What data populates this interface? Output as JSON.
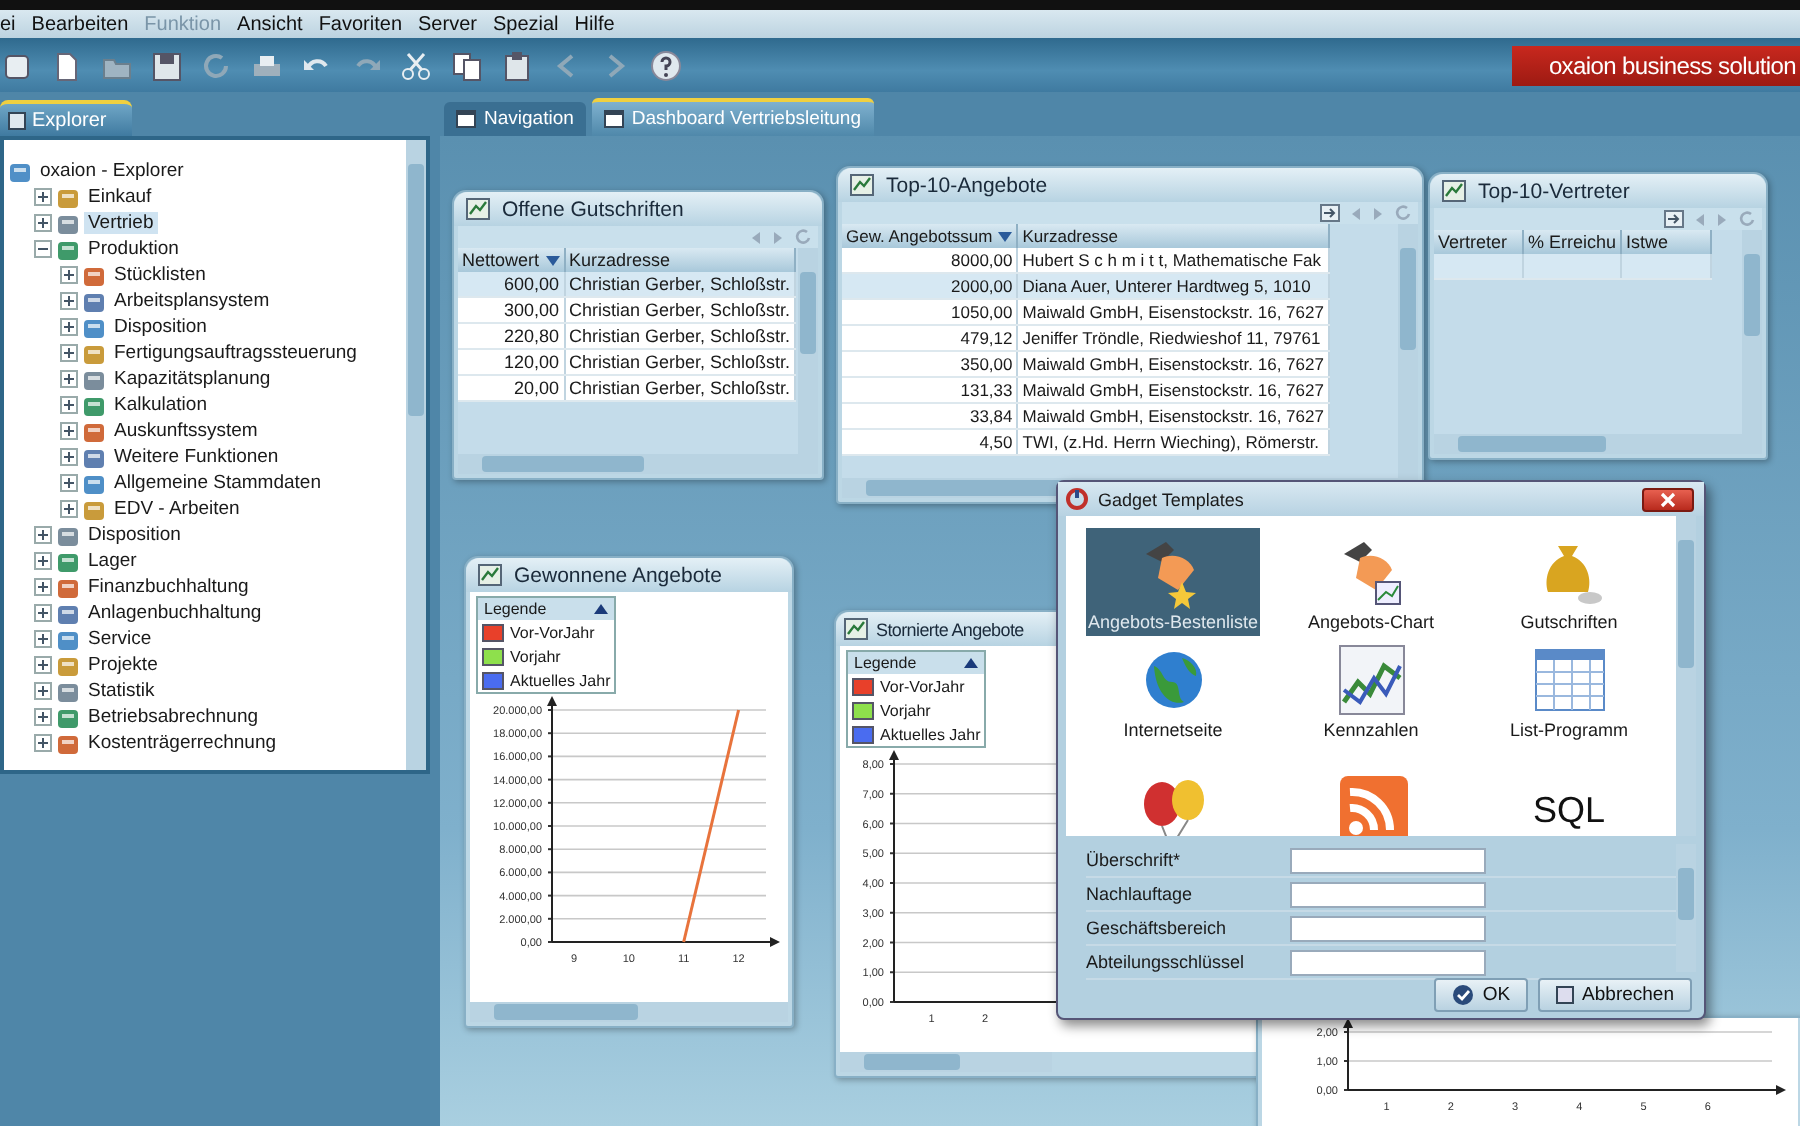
{
  "menu": [
    {
      "label": "ei",
      "disabled": false
    },
    {
      "label": "Bearbeiten",
      "disabled": false
    },
    {
      "label": "Funktion",
      "disabled": true
    },
    {
      "label": "Ansicht",
      "disabled": false
    },
    {
      "label": "Favoriten",
      "disabled": false
    },
    {
      "label": "Server",
      "disabled": false
    },
    {
      "label": "Spezial",
      "disabled": false
    },
    {
      "label": "Hilfe",
      "disabled": false
    }
  ],
  "logo": "oxaion business solution",
  "explorer": {
    "tab": "Explorer",
    "root": {
      "label": "oxaion - Explorer",
      "children": [
        {
          "label": "Einkauf",
          "expanded": false,
          "selected": false
        },
        {
          "label": "Vertrieb",
          "expanded": false,
          "selected": true
        },
        {
          "label": "Produktion",
          "expanded": true,
          "selected": false,
          "children": [
            {
              "label": "Stücklisten",
              "expanded": false,
              "selected": false
            },
            {
              "label": "Arbeitsplansystem",
              "expanded": false,
              "selected": false
            },
            {
              "label": "Disposition",
              "expanded": false,
              "selected": false
            },
            {
              "label": "Fertigungsauftragssteuerung",
              "expanded": false,
              "selected": false
            },
            {
              "label": "Kapazitätsplanung",
              "expanded": false,
              "selected": false
            },
            {
              "label": "Kalkulation",
              "expanded": false,
              "selected": false
            },
            {
              "label": "Auskunftssystem",
              "expanded": false,
              "selected": false
            },
            {
              "label": "Weitere Funktionen",
              "expanded": false,
              "selected": false
            },
            {
              "label": "Allgemeine Stammdaten",
              "expanded": false,
              "selected": false
            },
            {
              "label": "EDV - Arbeiten",
              "expanded": false,
              "selected": false
            }
          ]
        },
        {
          "label": "Disposition",
          "expanded": false,
          "selected": false
        },
        {
          "label": "Lager",
          "expanded": false,
          "selected": false
        },
        {
          "label": "Finanzbuchhaltung",
          "expanded": false,
          "selected": false
        },
        {
          "label": "Anlagenbuchhaltung",
          "expanded": false,
          "selected": false
        },
        {
          "label": "Service",
          "expanded": false,
          "selected": false
        },
        {
          "label": "Projekte",
          "expanded": false,
          "selected": false
        },
        {
          "label": "Statistik",
          "expanded": false,
          "selected": false
        },
        {
          "label": "Betriebsabrechnung",
          "expanded": false,
          "selected": false
        },
        {
          "label": "Kostenträgerrechnung",
          "expanded": false,
          "selected": false
        }
      ]
    }
  },
  "tabs": [
    {
      "label": "Navigation",
      "selected": false
    },
    {
      "label": "Dashboard Vertriebsleitung",
      "selected": true
    }
  ],
  "gadgets": [
    {
      "kind": "table",
      "title": "Offene Gutschriften",
      "columns": [
        {
          "label": "Nettowert",
          "sorted": true
        },
        {
          "label": "Kurzadresse",
          "sorted": false
        }
      ],
      "rows": [
        {
          "cells": [
            "600,00",
            "Christian Gerber, Schloßstr."
          ],
          "selected": true
        },
        {
          "cells": [
            "300,00",
            "Christian Gerber, Schloßstr."
          ],
          "selected": false
        },
        {
          "cells": [
            "220,80",
            "Christian Gerber, Schloßstr."
          ],
          "selected": false
        },
        {
          "cells": [
            "120,00",
            "Christian Gerber, Schloßstr."
          ],
          "selected": false
        },
        {
          "cells": [
            "20,00",
            "Christian Gerber, Schloßstr."
          ],
          "selected": false
        }
      ]
    },
    {
      "kind": "table",
      "title": "Top-10-Angebote",
      "columns": [
        {
          "label": "Gew. Angebotssum",
          "sorted": true
        },
        {
          "label": "Kurzadresse",
          "sorted": false
        }
      ],
      "rows": [
        {
          "cells": [
            "8000,00",
            "Hubert S c h m i t t, Mathematische Fak"
          ],
          "selected": false
        },
        {
          "cells": [
            "2000,00",
            "Diana Auer, Unterer Hardtweg 5, 1010"
          ],
          "selected": true
        },
        {
          "cells": [
            "1050,00",
            "Maiwald GmbH, Eisenstockstr. 16, 7627"
          ],
          "selected": false
        },
        {
          "cells": [
            "479,12",
            "Jeniffer Tröndle, Riedwieshof 11, 79761"
          ],
          "selected": false
        },
        {
          "cells": [
            "350,00",
            "Maiwald GmbH, Eisenstockstr. 16, 7627"
          ],
          "selected": false
        },
        {
          "cells": [
            "131,33",
            "Maiwald GmbH, Eisenstockstr. 16, 7627"
          ],
          "selected": false
        },
        {
          "cells": [
            "33,84",
            "Maiwald GmbH, Eisenstockstr. 16, 7627"
          ],
          "selected": false
        },
        {
          "cells": [
            "4,50",
            "TWI, (z.Hd. Herrn Wieching), Römerstr."
          ],
          "selected": false
        }
      ]
    },
    {
      "kind": "table",
      "title": "Top-10-Vertreter",
      "columns": [
        {
          "label": "Vertreter",
          "sorted": false
        },
        {
          "label": "% Erreichu",
          "sorted": false
        },
        {
          "label": "Istwe",
          "sorted": false
        }
      ]
    },
    {
      "kind": "chart",
      "title": "Gewonnene Angebote",
      "legend": {
        "title": "Legende",
        "items": [
          {
            "label": "Vor-VorJahr",
            "color": "#e8402a"
          },
          {
            "label": "Vorjahr",
            "color": "#8ee04c"
          },
          {
            "label": "Aktuelles Jahr",
            "color": "#4a6cf0"
          }
        ]
      },
      "chart_data": {
        "type": "line",
        "grid": true,
        "categories": [
          "9",
          "10",
          "11",
          "12"
        ],
        "series": [
          {
            "color": "#e8733c",
            "values": [
              null,
              null,
              0,
              20000
            ]
          }
        ],
        "ylim": [
          0,
          20000
        ],
        "yticks": [
          {
            "value": 0,
            "label": "0,00"
          },
          {
            "value": 2000,
            "label": "2.000,00"
          },
          {
            "value": 4000,
            "label": "4.000,00"
          },
          {
            "value": 6000,
            "label": "6.000,00"
          },
          {
            "value": 8000,
            "label": "8.000,00"
          },
          {
            "value": 10000,
            "label": "10.000,00"
          },
          {
            "value": 12000,
            "label": "12.000,00"
          },
          {
            "value": 14000,
            "label": "14.000,00"
          },
          {
            "value": 16000,
            "label": "16.000,00"
          },
          {
            "value": 18000,
            "label": "18.000,00"
          },
          {
            "value": 20000,
            "label": "20.000,00"
          }
        ]
      }
    },
    {
      "kind": "chart",
      "title": "Stornierte Angebote",
      "legend": {
        "title": "Legende",
        "items": [
          {
            "label": "Vor-VorJahr",
            "color": "#e8402a"
          },
          {
            "label": "Vorjahr",
            "color": "#8ee04c"
          },
          {
            "label": "Aktuelles Jahr",
            "color": "#4a6cf0"
          }
        ]
      },
      "chart_data": {
        "type": "line",
        "grid": true,
        "xlim": [
          0.3,
          6.5
        ],
        "ylim": [
          0,
          8
        ],
        "xticks": [
          1,
          2
        ],
        "yticks": [
          {
            "value": 0,
            "label": "0,00"
          },
          {
            "value": 1,
            "label": "1,00"
          },
          {
            "value": 2,
            "label": "2,00"
          },
          {
            "value": 3,
            "label": "3,00"
          },
          {
            "value": 4,
            "label": "4,00"
          },
          {
            "value": 5,
            "label": "5,00"
          },
          {
            "value": 6,
            "label": "6,00"
          },
          {
            "value": 7,
            "label": "7,00"
          },
          {
            "value": 8,
            "label": "8,00"
          }
        ]
      }
    },
    {
      "kind": "chart",
      "chart_data": {
        "type": "line",
        "grid": true,
        "xlim": [
          0.4,
          7
        ],
        "ylim": [
          0,
          2
        ],
        "xticks": [
          1,
          2,
          3,
          4,
          5,
          6
        ],
        "yticks": [
          {
            "value": 0,
            "label": "0,00"
          },
          {
            "value": 1,
            "label": "1,00"
          },
          {
            "value": 2,
            "label": "2,00"
          }
        ]
      }
    }
  ],
  "dialog": {
    "title": "Gadget Templates",
    "templates": [
      {
        "kind": "hand-star",
        "label": "Angebots-Bestenliste",
        "selected": true
      },
      {
        "kind": "hand-chart",
        "label": "Angebots-Chart",
        "selected": false
      },
      {
        "kind": "money-bag",
        "label": "Gutschriften",
        "selected": false
      },
      {
        "kind": "globe",
        "label": "Internetseite",
        "selected": false
      },
      {
        "kind": "line-chart",
        "label": "Kennzahlen",
        "selected": false
      },
      {
        "kind": "table",
        "label": "List-Programm",
        "selected": false
      },
      {
        "kind": "balloons",
        "selected": false
      },
      {
        "kind": "rss",
        "selected": false
      },
      {
        "kind": "sql",
        "icon_text": "SQL",
        "selected": false
      }
    ],
    "fields": [
      {
        "label": "Überschrift*"
      },
      {
        "label": "Nachlauftage"
      },
      {
        "label": "Geschäftsbereich"
      },
      {
        "label": "Abteilungsschlüssel"
      }
    ],
    "buttons": [
      {
        "kind": "ok",
        "label": "OK"
      },
      {
        "kind": "cancel",
        "label": "Abbrechen"
      }
    ]
  }
}
